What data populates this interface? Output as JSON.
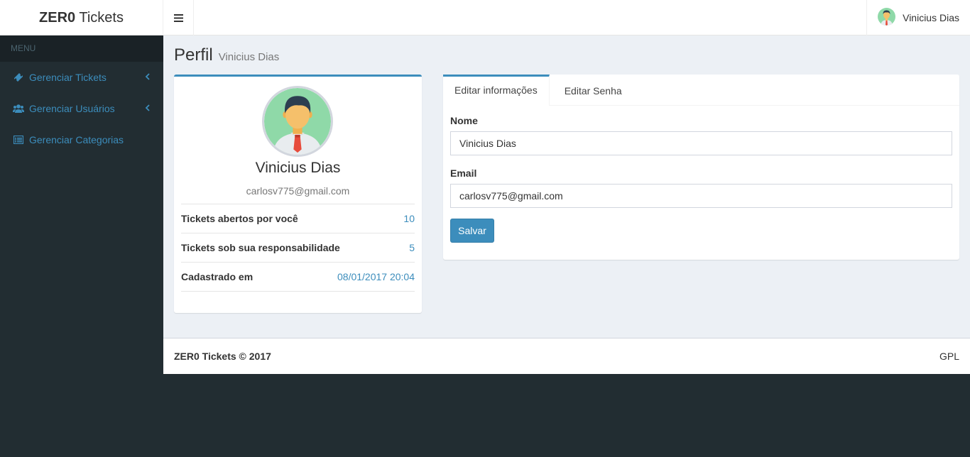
{
  "header": {
    "logo_bold": "ZER0",
    "logo_rest": " Tickets",
    "user_name": "Vinicius Dias",
    "toggle_icon": "hamburger-icon"
  },
  "sidebar": {
    "menu_header": "MENU",
    "items": [
      {
        "label": "Gerenciar Tickets",
        "icon": "ticket-icon",
        "has_chevron": true
      },
      {
        "label": "Gerenciar Usuários",
        "icon": "users-icon",
        "has_chevron": true
      },
      {
        "label": "Gerenciar Categorias",
        "icon": "list-icon",
        "has_chevron": false
      }
    ]
  },
  "page": {
    "title": "Perfil",
    "subtitle": "Vinicius Dias"
  },
  "profile": {
    "name": "Vinicius Dias",
    "email": "carlosv775@gmail.com",
    "stats": [
      {
        "label": "Tickets abertos por você",
        "value": "10"
      },
      {
        "label": "Tickets sob sua responsabilidade",
        "value": "5"
      },
      {
        "label": "Cadastrado em",
        "value": "08/01/2017 20:04"
      }
    ]
  },
  "tabs": [
    {
      "label": "Editar informações",
      "active": true
    },
    {
      "label": "Editar Senha",
      "active": false
    }
  ],
  "form": {
    "name_label": "Nome",
    "name_value": "Vinicius Dias",
    "email_label": "Email",
    "email_value": "carlosv775@gmail.com",
    "save_label": "Salvar"
  },
  "footer": {
    "copyright": "ZER0 Tickets © 2017",
    "license": "GPL"
  },
  "colors": {
    "primary": "#3c8dbc",
    "sidebar_bg": "#222d32",
    "content_bg": "#ecf0f5"
  }
}
